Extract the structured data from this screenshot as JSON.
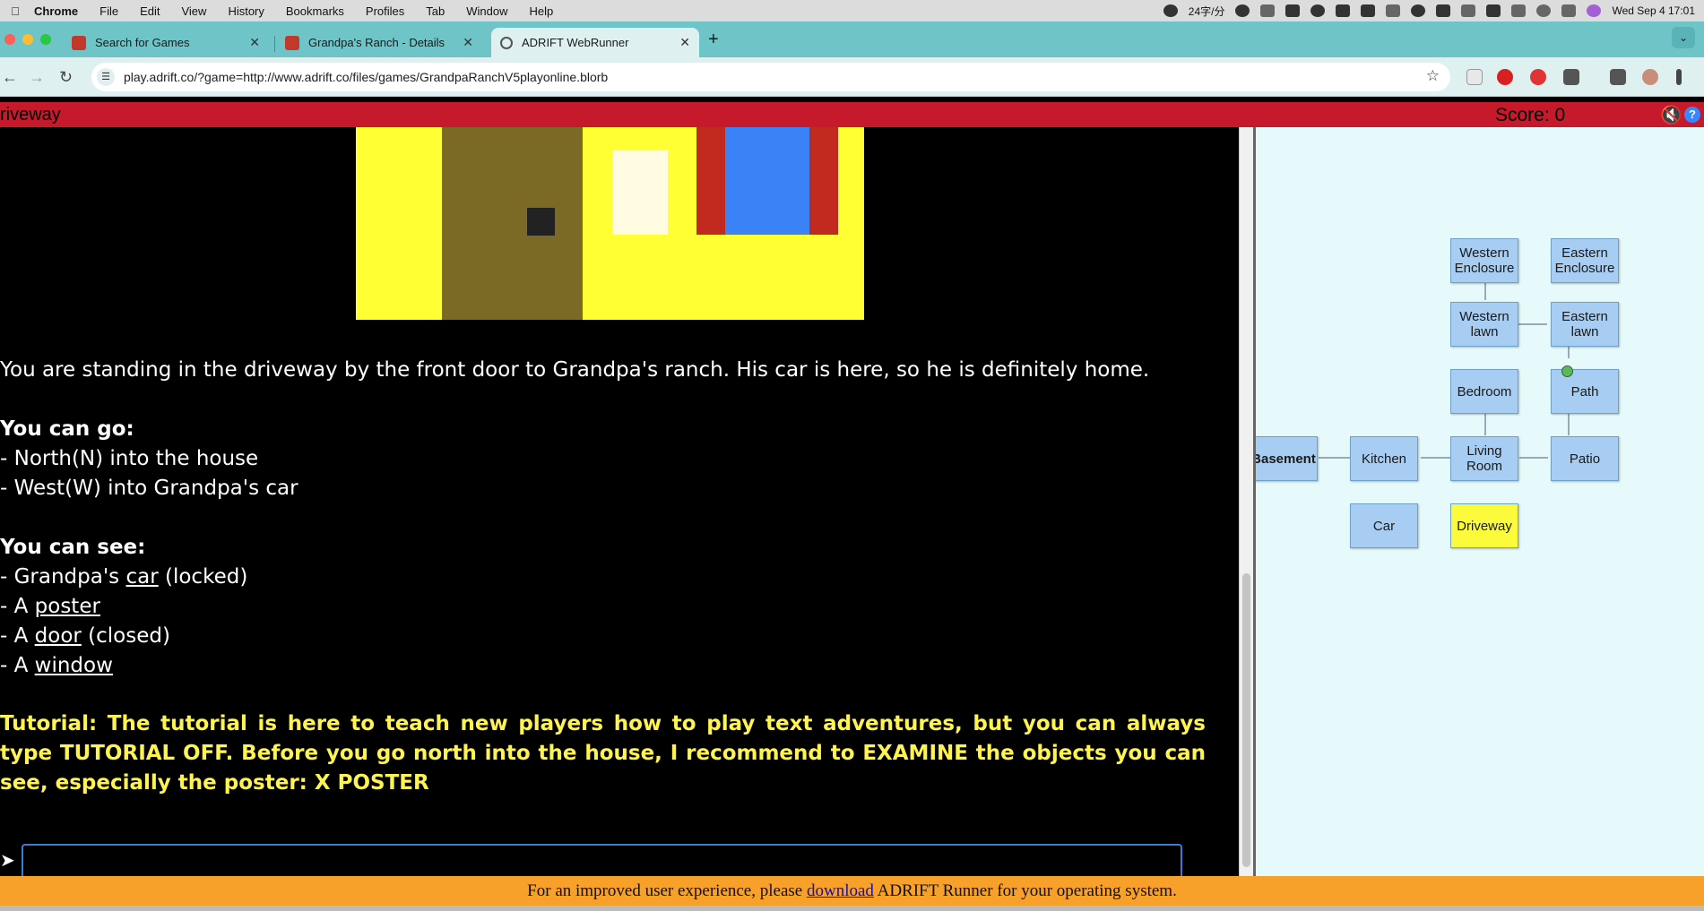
{
  "menubar": {
    "app": "Chrome",
    "items": [
      "File",
      "Edit",
      "View",
      "History",
      "Bookmarks",
      "Profiles",
      "Tab",
      "Window",
      "Help"
    ],
    "input_rate": "24字/分",
    "datetime": "Wed Sep 4  17:01"
  },
  "tabs": [
    {
      "title": "Search for Games"
    },
    {
      "title": "Grandpa's Ranch - Details"
    },
    {
      "title": "ADRIFT WebRunner"
    }
  ],
  "address": {
    "url": "play.adrift.co/?game=http://www.adrift.co/files/games/GrandpaRanchV5playonline.blorb"
  },
  "game": {
    "location": "riveway",
    "score": "Score: 0",
    "description": "You are standing in the driveway by the front door to Grandpa's ranch. His car is here, so he is definitely home.",
    "exits_heading": "You can go:",
    "exits": [
      "- North(N) into the house",
      "- West(W) into Grandpa's car"
    ],
    "see_heading": "You can see:",
    "objects": [
      {
        "prefix": "- Grandpa's ",
        "link": "car",
        "suffix": " (locked)"
      },
      {
        "prefix": "- A ",
        "link": "poster",
        "suffix": ""
      },
      {
        "prefix": "- A ",
        "link": "door",
        "suffix": " (closed)"
      },
      {
        "prefix": "- A ",
        "link": "window",
        "suffix": ""
      }
    ],
    "tutorial": "Tutorial: The tutorial is here to teach new players how to play text adventures, but you can always type TUTORIAL OFF. Before you go north into the house, I recommend to EXAMINE the objects you can see, especially the poster: X POSTER",
    "input_value": ""
  },
  "map": {
    "rooms": {
      "western_enclosure": "Western Enclosure",
      "eastern_enclosure": "Eastern Enclosure",
      "western_lawn": "Western lawn",
      "eastern_lawn": "Eastern lawn",
      "bedroom": "Bedroom",
      "path": "Path",
      "basement": "Basement",
      "kitchen": "Kitchen",
      "living_room": "Living Room",
      "patio": "Patio",
      "car": "Car",
      "driveway": "Driveway"
    },
    "current_room": "Driveway",
    "current_room_color": "#fbfb3c"
  },
  "notice": {
    "before": "For an improved user experience, please ",
    "link": "download",
    "after": " ADRIFT Runner for your operating system."
  },
  "colors": {
    "game_bar": "#c61a2c",
    "tutorial_text": "#fff44f",
    "notice_bar": "#f7a12b",
    "tab_bar": "#6fc4c8"
  }
}
